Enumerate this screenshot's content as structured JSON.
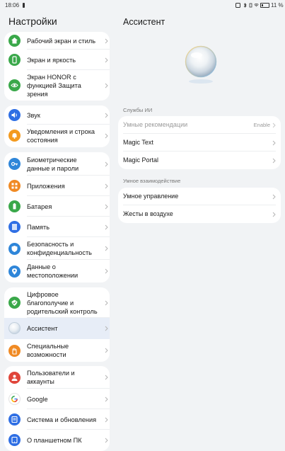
{
  "status_bar": {
    "time": "18:06",
    "battery": "11 %"
  },
  "left": {
    "title": "Настройки",
    "groups": [
      {
        "items": [
          {
            "label": "Рабочий экран и стиль",
            "icon": "home-style-icon",
            "color": "#3aa84a"
          },
          {
            "label": "Экран и яркость",
            "icon": "display-icon",
            "color": "#3aa84a"
          },
          {
            "label": "Экран HONOR с функцией Защита зрения",
            "icon": "eye-protection-icon",
            "color": "#3aa84a"
          }
        ]
      },
      {
        "items": [
          {
            "label": "Звук",
            "icon": "sound-icon",
            "color": "#2f6fe4"
          },
          {
            "label": "Уведомления и строка состояния",
            "icon": "notification-bell-icon",
            "color": "#f39a1e"
          }
        ]
      },
      {
        "items": [
          {
            "label": "Биометрические данные и пароли",
            "icon": "key-icon",
            "color": "#2f86d9"
          },
          {
            "label": "Приложения",
            "icon": "apps-grid-icon",
            "color": "#f08a24"
          },
          {
            "label": "Батарея",
            "icon": "battery-icon",
            "color": "#3aa84a"
          },
          {
            "label": "Память",
            "icon": "storage-icon",
            "color": "#2f6fe4"
          },
          {
            "label": "Безопасность и конфиденциальность",
            "icon": "shield-icon",
            "color": "#2f86d9"
          },
          {
            "label": "Данные о местоположении",
            "icon": "location-pin-icon",
            "color": "#2f86d9"
          }
        ]
      },
      {
        "items": [
          {
            "label": "Цифровое благополучие и родительский контроль",
            "icon": "wellbeing-icon",
            "color": "#3aa84a"
          },
          {
            "label": "Ассистент",
            "icon": "assistant-orb-icon",
            "color": "#dfe6ee"
          },
          {
            "label": "Специальные возможности",
            "icon": "accessibility-hand-icon",
            "color": "#f08a24"
          }
        ]
      },
      {
        "items": [
          {
            "label": "Пользователи и аккаунты",
            "icon": "user-icon",
            "color": "#e0453a"
          },
          {
            "label": "Google",
            "icon": "google-icon",
            "color": "#ffffff"
          },
          {
            "label": "Система и обновления",
            "icon": "system-update-icon",
            "color": "#2f6fe4"
          },
          {
            "label": "О планшетном ПК",
            "icon": "tablet-info-icon",
            "color": "#2f6fe4"
          }
        ]
      }
    ]
  },
  "right": {
    "title": "Ассистент",
    "sections": [
      {
        "label": "Службы ИИ",
        "items": [
          {
            "label": "Умные рекомендации",
            "value": "Enable",
            "disabled": true
          },
          {
            "label": "Magic Text",
            "value": ""
          },
          {
            "label": "Magic Portal",
            "value": ""
          }
        ]
      },
      {
        "label": "Умное взаимодействие",
        "items": [
          {
            "label": "Умное управление",
            "value": ""
          },
          {
            "label": "Жесты в воздухе",
            "value": ""
          }
        ]
      }
    ]
  }
}
